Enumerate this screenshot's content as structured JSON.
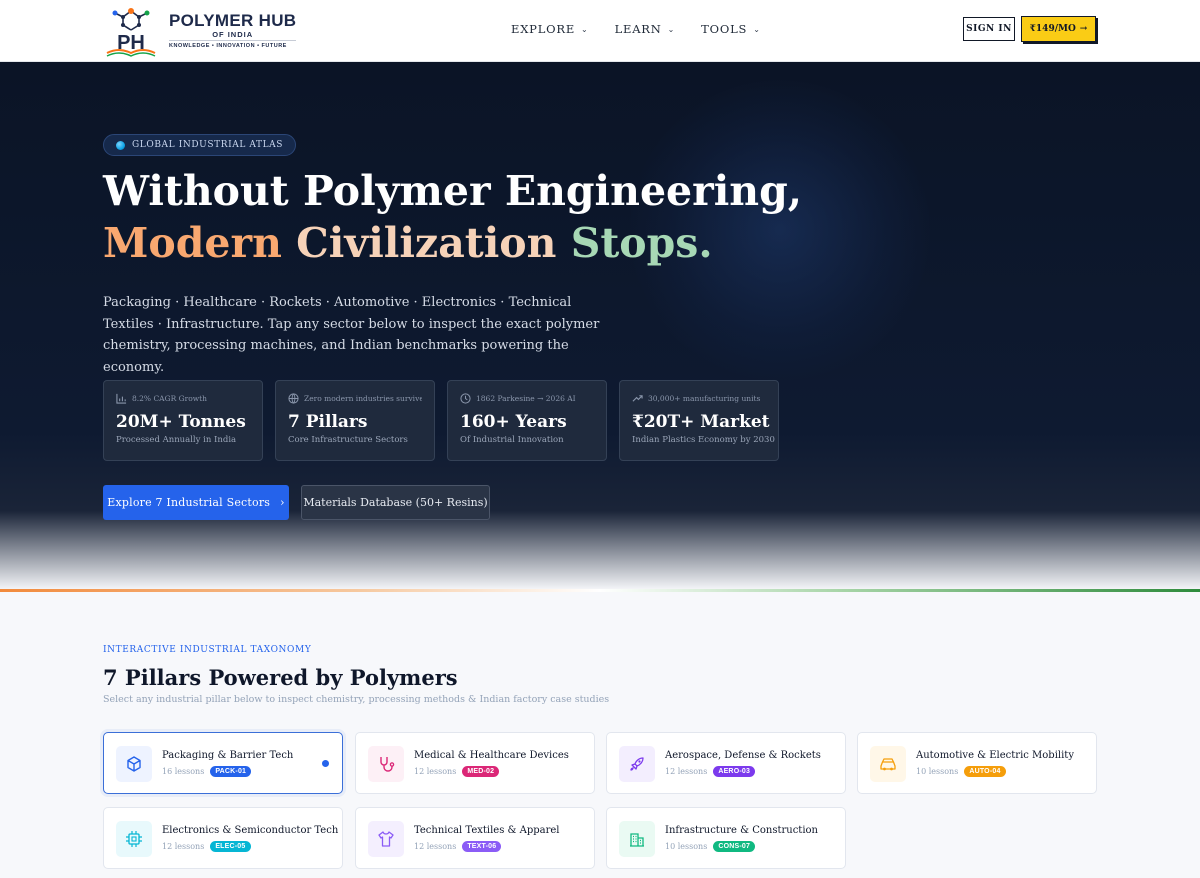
{
  "header": {
    "logo_title": "POLYMER HUB",
    "logo_subtitle": "OF INDIA",
    "logo_tagline": "KNOWLEDGE • INNOVATION • FUTURE",
    "logo_mark_text": "PH",
    "nav": [
      {
        "label": "EXPLORE"
      },
      {
        "label": "LEARN"
      },
      {
        "label": "TOOLS"
      }
    ],
    "signin_label": "SIGN IN",
    "price_label": "₹149/MO",
    "price_arrow": "→"
  },
  "hero": {
    "pill_label": "GLOBAL INDUSTRIAL ATLAS",
    "headline_line1": "Without Polymer Engineering,",
    "headline_line2_part1": "Modern ",
    "headline_line2_part2": "Civilization ",
    "headline_line2_part3": "Stops.",
    "description": "Packaging · Healthcare · Rockets · Automotive · Electronics · Technical Textiles · Infrastructure. Tap any sector below to inspect the exact polymer chemistry, processing machines, and Indian benchmarks powering the economy.",
    "stats": [
      {
        "icon": "bar-chart-icon",
        "caption": "8.2% CAGR Growth",
        "value": "20M+ Tonnes",
        "label": "Processed Annually in India"
      },
      {
        "icon": "globe-icon",
        "caption": "Zero modern industries survive with...",
        "value": "7 Pillars",
        "label": "Core Infrastructure Sectors"
      },
      {
        "icon": "clock-icon",
        "caption": "1862 Parkesine → 2026 AI",
        "value": "160+ Years",
        "label": "Of Industrial Innovation"
      },
      {
        "icon": "trending-up-icon",
        "caption": "30,000+ manufacturing units",
        "value": "₹20T+ Market",
        "label": "Indian Plastics Economy by 2030"
      }
    ],
    "primary_button": "Explore 7 Industrial Sectors",
    "primary_arrow": "›",
    "secondary_button": "Materials Database (50+ Resins)"
  },
  "section": {
    "kicker": "INTERACTIVE INDUSTRIAL TAXONOMY",
    "title": "7 Pillars Powered by Polymers",
    "subtitle": "Select any industrial pillar below to inspect chemistry, processing methods & Indian factory case studies",
    "cards": [
      {
        "title": "Packaging & Barrier Tech",
        "lessons": "16 lessons",
        "code": "PACK-01",
        "icon": "box-icon",
        "color": "#2563eb",
        "bg": "#eef3ff",
        "active": true
      },
      {
        "title": "Medical & Healthcare Devices",
        "lessons": "12 lessons",
        "code": "MED-02",
        "icon": "stethoscope-icon",
        "color": "#db2777",
        "bg": "#fdf0f6"
      },
      {
        "title": "Aerospace, Defense & Rockets",
        "lessons": "12 lessons",
        "code": "AERO-03",
        "icon": "rocket-icon",
        "color": "#7c3aed",
        "bg": "#f3eefe"
      },
      {
        "title": "Automotive & Electric Mobility",
        "lessons": "10 lessons",
        "code": "AUTO-04",
        "icon": "car-icon",
        "color": "#f59e0b",
        "bg": "#fff7e8"
      },
      {
        "title": "Electronics & Semiconductor Tech",
        "lessons": "12 lessons",
        "code": "ELEC-05",
        "icon": "chip-icon",
        "color": "#06b6d4",
        "bg": "#e8f9fc"
      },
      {
        "title": "Technical Textiles & Apparel",
        "lessons": "12 lessons",
        "code": "TEXT-06",
        "icon": "shirt-icon",
        "color": "#8b5cf6",
        "bg": "#f4effe"
      },
      {
        "title": "Infrastructure & Construction",
        "lessons": "10 lessons",
        "code": "CONS-07",
        "icon": "building-icon",
        "color": "#10b981",
        "bg": "#eafaf3"
      }
    ]
  }
}
